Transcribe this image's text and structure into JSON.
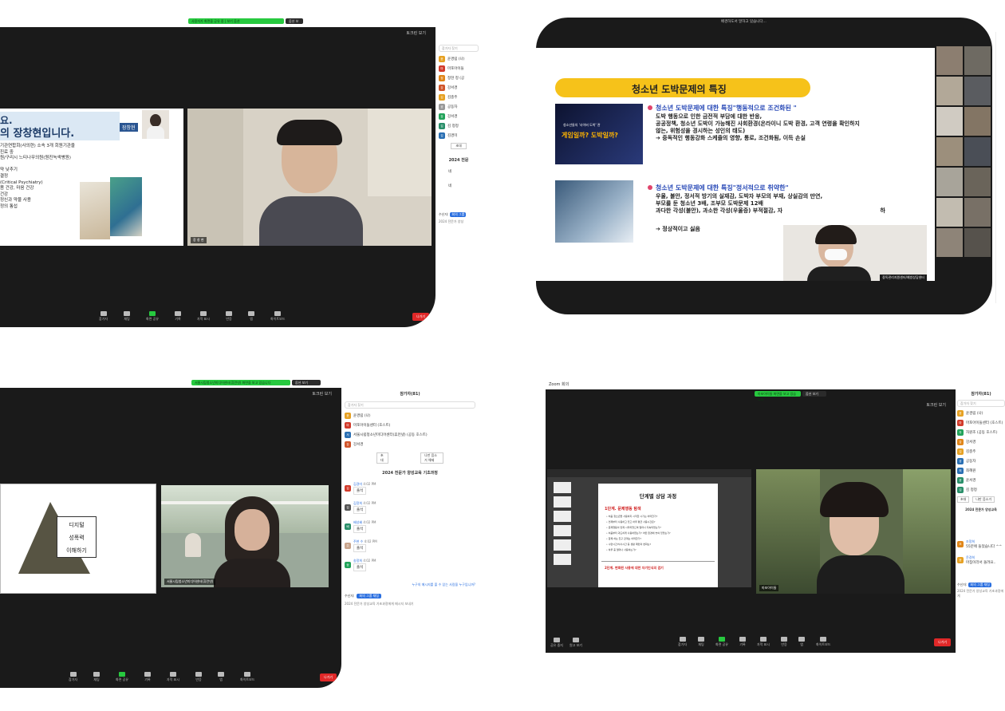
{
  "p1": {
    "banner": "사용자가 화면을 공유 중 | 보기 옵션",
    "view_btn": "옵션 보기",
    "top_right": "토크린  보기",
    "slide_lines": [
      "요.",
      "의 장창현입니다."
    ],
    "slide_name_tag": "장창현",
    "slide_bullets": [
      "기관연합회(사의련) 소속 3개 회원기관을",
      "진료 중",
      "원/구리시 느티나무의원(원진녹색병원)",
      "",
      "약 낮추기",
      "결정",
      "(Critical Psychiatry)",
      "몸 건강, 마음 건강",
      "건강",
      "정신과 약물 사용",
      "정의 통섭"
    ],
    "speaker_name": "장 창 현",
    "toolbar": [
      "참가자",
      "채팅",
      "화면 공유",
      "기록",
      "자막 표시",
      "반응",
      "앱",
      "화이트보드"
    ],
    "leave": "나가기",
    "sidebar_search": "참가자 찾기",
    "sidebar_items": [
      "윤경림 (나)",
      "마포아이들",
      "정현 정 (공",
      "강서경",
      "김충주",
      "공동자",
      "강서경",
      "김 청정",
      "김경미"
    ],
    "more_btn": "초대",
    "chat_title": "2024 전문",
    "chat_msgs": [
      "네",
      "네"
    ],
    "recipient_label": "수신자:",
    "recipient_btn": "회의 그룹",
    "chat_placeholder": "2024 전문가 양성"
  },
  "p2": {
    "top_notice": "배경하도서 말하고 있습니다...",
    "slide_title": "청소년 도박문제의 특징",
    "thumb1_text": "게임일까? 도박일까?",
    "thumb1_sub": "청소년들의 '사이버 도박' 관",
    "s1_head": "청소년 도박문제에 대한 특징\"행동적으로 조건화된 \"",
    "s1_lines": [
      "도박 행동으로 인한 금전적 부담에 대한 반응,",
      "공공정책, 청소년 도박이 가능해진 사회환경(온라이니 도박 환경, 고객 연령을 확인하지",
      "않는, 위험성을 경시하는 성인의 태도)"
    ],
    "s1_arrow": "➔ 중독적인 행동강화 스케줄의 영향, 통로, 조건화됨, 이득 손실",
    "s2_head": "청소년 도박문제에 대한 특징\"정서적으로 취약한\"",
    "s2_lines": [
      "우울, 불안, 정서적 방기의 실재감, 도박자 부모의 부재, 상실감의 만연,",
      "부모를 둔 청소년 3배, 조부모 도박문제 12배",
      "과다한 각성(불안), 과소한 각성(우울증) 부적절감, 자"
    ],
    "s2_tail": "하",
    "s2_arrow": "➔ 정상적이고 싫음",
    "speaker_tag": "중독관리지원센터/예방상담센터"
  },
  "p3": {
    "banner": "서울시립청소년미디어센터(휴먼넷) 화면을 보고 있습니다",
    "view_btn": "옵션 보기",
    "top_right": "토크린  보기",
    "triangle_labels": [
      "디지털",
      "성폭력",
      "이해하기"
    ],
    "speaker_name": "서울시립청소년미디어센터(휴먼넷)",
    "toolbar": [
      "참가자",
      "채팅",
      "화면 공유",
      "기록",
      "자막 표시",
      "반응",
      "앱",
      "화이트보드"
    ],
    "leave": "나가기",
    "sidebar_title": "참가자(81)",
    "sidebar_search": "참가자 찾기",
    "sidebar_items": [
      "윤경림 (나)",
      "마포아이들센터 (호스트)",
      "서울시립청소년미디어센터(휴먼넷) (공동 호스트)",
      "강서경"
    ],
    "invite_btn": "초대",
    "mute_btn": "나만 음소거 해제",
    "chat_title": "2024 전문가 양성교육 기초과정",
    "chat_msgs": [
      {
        "name": "김경미",
        "time": "4:02 PM",
        "text": "출석"
      },
      {
        "name": "김정희",
        "time": "4:02 PM",
        "text": "출석"
      },
      {
        "name": "배성혜",
        "time": "4:02 PM",
        "text": "출석"
      },
      {
        "name": "주현 수",
        "time": "4:02 PM",
        "text": "출석"
      },
      {
        "name": "송정희",
        "time": "4:02 PM",
        "text": "출석"
      }
    ],
    "chat_hint": "누구의 메시지를 볼 수 있는 사람을 누구입니까?",
    "recipient_label": "수신자:",
    "recipient_btn": "회의 그룹 채팅",
    "chat_placeholder": "2024 전문가 양성교육 기초과정에게 메시지 보내기"
  },
  "p4": {
    "window_title": "Zoom 회의",
    "banner": "마포아이들 화면을 보고 있습니다",
    "view_btn": "옵션 보기",
    "top_right": "토크린  보기",
    "slide_title": "단계별 상담 과정",
    "slide_sub": "1단계. 문제행동 탐색",
    "slide_lines": [
      "• 처음 청소년들 사용하지 시작한 시기는 어떠한가?",
      "• 언제부터 사용하고 있고 하루 평균 사용시간은?",
      "• 문제행동이 언제 시작되었으며 얼마나 지속되었는가?",
      "• 처음부터 과도하게 사용하였는가? 어떤 환경에 놓여 있었는가?",
      "• 함께 하는 친구 관계는 어떠한가?",
      "• 수면시간/식사시간 등 생활 패턴의 변화는?",
      "• 하루 중 얼마나 사용하는가?"
    ],
    "slide_sub2": "2단계. 변화된 사용에 대한 자기인식의 검기",
    "speaker_name": "마포아이들",
    "toolbar": [
      "참가자",
      "채팅",
      "화면 공유",
      "기록",
      "자막 표시",
      "반응",
      "앱",
      "화이트보드"
    ],
    "left_tools": [
      "공유 중지",
      "원고 보기"
    ],
    "leave": "나가기",
    "sidebar_title": "참가자(81)",
    "sidebar_search": "참가자 찾기",
    "sidebar_items": [
      "윤경림 (나)",
      "마포아이들센터 (호스트)",
      "자원조 (공동 호스트)",
      "강서경",
      "김충주",
      "공동자",
      "최혜원",
      "윤서경",
      "김 청정"
    ],
    "invite_btn": "초대",
    "mute_btn": "나만 음소거",
    "chat_title": "2024 전문가 양성교육",
    "chat_msgs": [
      {
        "name": "조정희",
        "text": "55분에 들었습니다 ^^"
      },
      {
        "name": "윤경희",
        "text": "마칩이라서 돌려요.."
      }
    ],
    "recipient_label": "수신자:",
    "recipient_btn": "회의 그룹 채팅",
    "chat_placeholder": "2024 전문가 양성교육 기초과정에게"
  },
  "colors": {
    "zoom_bg": "#1a1a1a",
    "banner_green": "#27c93f",
    "leave_red": "#e02828",
    "slide_yellow": "#f6c21a",
    "bullet_pink": "#e0446c",
    "slide_red": "#d02020"
  }
}
